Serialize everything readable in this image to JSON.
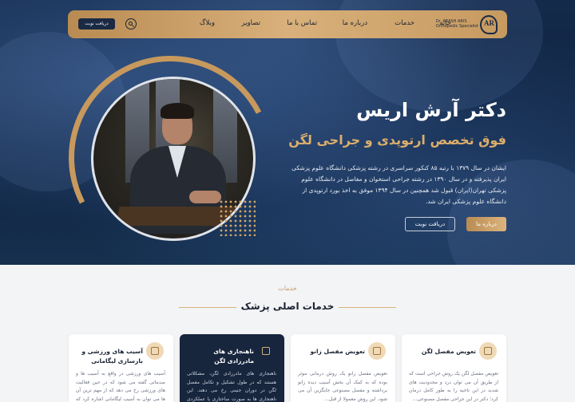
{
  "nav": {
    "logo_mark": "AR",
    "logo_line1": "Dr. ARASH ARIS",
    "logo_line2": "Orthopedic Specialist",
    "links": [
      "خانه",
      "خدمات",
      "درباره ما",
      "تماس با ما",
      "تصاویر",
      "وبلاگ"
    ],
    "cta": "دریافت نوبت"
  },
  "hero": {
    "title": "دکتر آرش اریس",
    "subtitle": "فوق تخصص ارتوپدی و جراحی لگن",
    "paragraph": "ایشان در سال ۱۳۷۹ با رتبه ۸۵ کنکور سراسری در رشته پزشکی دانشگاه علوم پزشکی ایران پذیرفته و در سال ۱۳۹۰ در رشته جراحی استخوان و مفاصل در دانشگاه علوم پزشکی تهران(ایران) قبول شد همچنین در سال ۱۳۹۴ موفق به اخذ بورد ارتوپدی از دانشگاه علوم پزشکی ایران شد.",
    "about_button": "درباره ما",
    "booking_button": "دریافت نوبت"
  },
  "services": {
    "label": "خدمات",
    "title": "خدمات اصلی پزشک",
    "cards": [
      {
        "title": "تعویض مفصل لگن",
        "text": "تعویض مفصل لگن یک روش جراحی است که از طریق آن می توان درد و محدودیت های شدید در این ناحیه را به طور کامل درمان کرد؛ دکتر در این جراحی مفصل مصنوعی..."
      },
      {
        "title": "تعویض مفصل زانو",
        "text": "تعویض مفصل زانو یک روش درمانی موثر بوده که به کمک آن بخش آسیب دیده زانو برداشته و مفصل مصنوعی جایگزین آن می شود. این روش معمولا از قبل..."
      },
      {
        "title": "ناهنجاری های مادرزادی لگن",
        "text": "ناهنجاری های مادرزادی لگن، مشکلاتی هستند که در طول تشکیل و تکامل مفصل لگن در دوران جنینی رخ می دهند. این ناهنجاری ها به صورت ساختاری یا عملکردی هستند. از مهم..."
      },
      {
        "title": "آسیب های ورزشی و بازسازی لیگامانی",
        "text": "آسیب های ورزشی در واقع به آسیب ها و صدماتی گفته می شود که در حین فعالیت های ورزشی رخ می دهد که از مهم ترین آن ها می توان به آسیب لیگامانی اشاره کرد که بیشتر در..."
      }
    ]
  }
}
